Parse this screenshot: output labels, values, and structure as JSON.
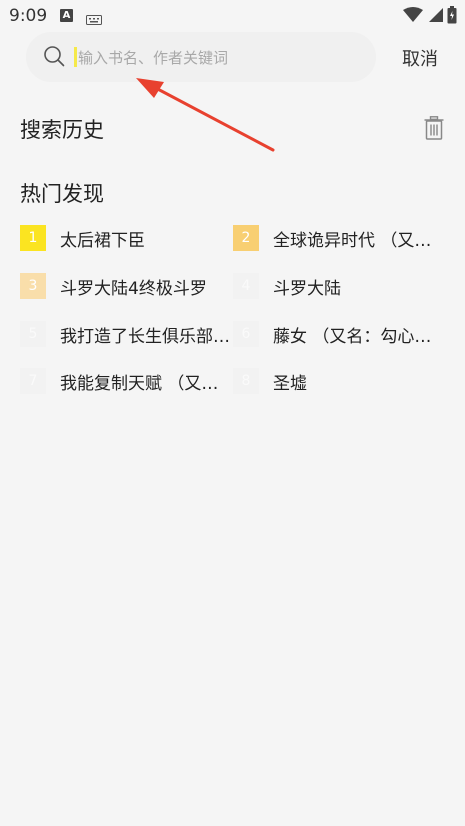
{
  "status_bar": {
    "time": "9:09",
    "input_badge": "A"
  },
  "search": {
    "placeholder": "输入书名、作者关键词",
    "value": "",
    "cancel_label": "取消"
  },
  "history": {
    "title": "搜索历史"
  },
  "hot": {
    "title": "热门发现",
    "items": [
      {
        "rank": "1",
        "title": "太后裙下臣",
        "rank_color": "#fbe421"
      },
      {
        "rank": "2",
        "title": "全球诡异时代 （又名…",
        "rank_color": "#f8cf72"
      },
      {
        "rank": "3",
        "title": "斗罗大陆4终极斗罗",
        "rank_color": "#f9deaa"
      },
      {
        "rank": "4",
        "title": "斗罗大陆",
        "rank_color": "#f2f2f2"
      },
      {
        "rank": "5",
        "title": "我打造了长生俱乐部…",
        "rank_color": "#f2f2f2"
      },
      {
        "rank": "6",
        "title": "藤女 （又名：勾心斗…",
        "rank_color": "#f2f2f2"
      },
      {
        "rank": "7",
        "title": "我能复制天赋 （又名…",
        "rank_color": "#f2f2f2"
      },
      {
        "rank": "8",
        "title": "圣墟",
        "rank_color": "#f2f2f2"
      }
    ]
  },
  "colors": {
    "background": "#f5f5f5",
    "search_bg": "#f0f0f0",
    "arrow": "#e8412f"
  }
}
